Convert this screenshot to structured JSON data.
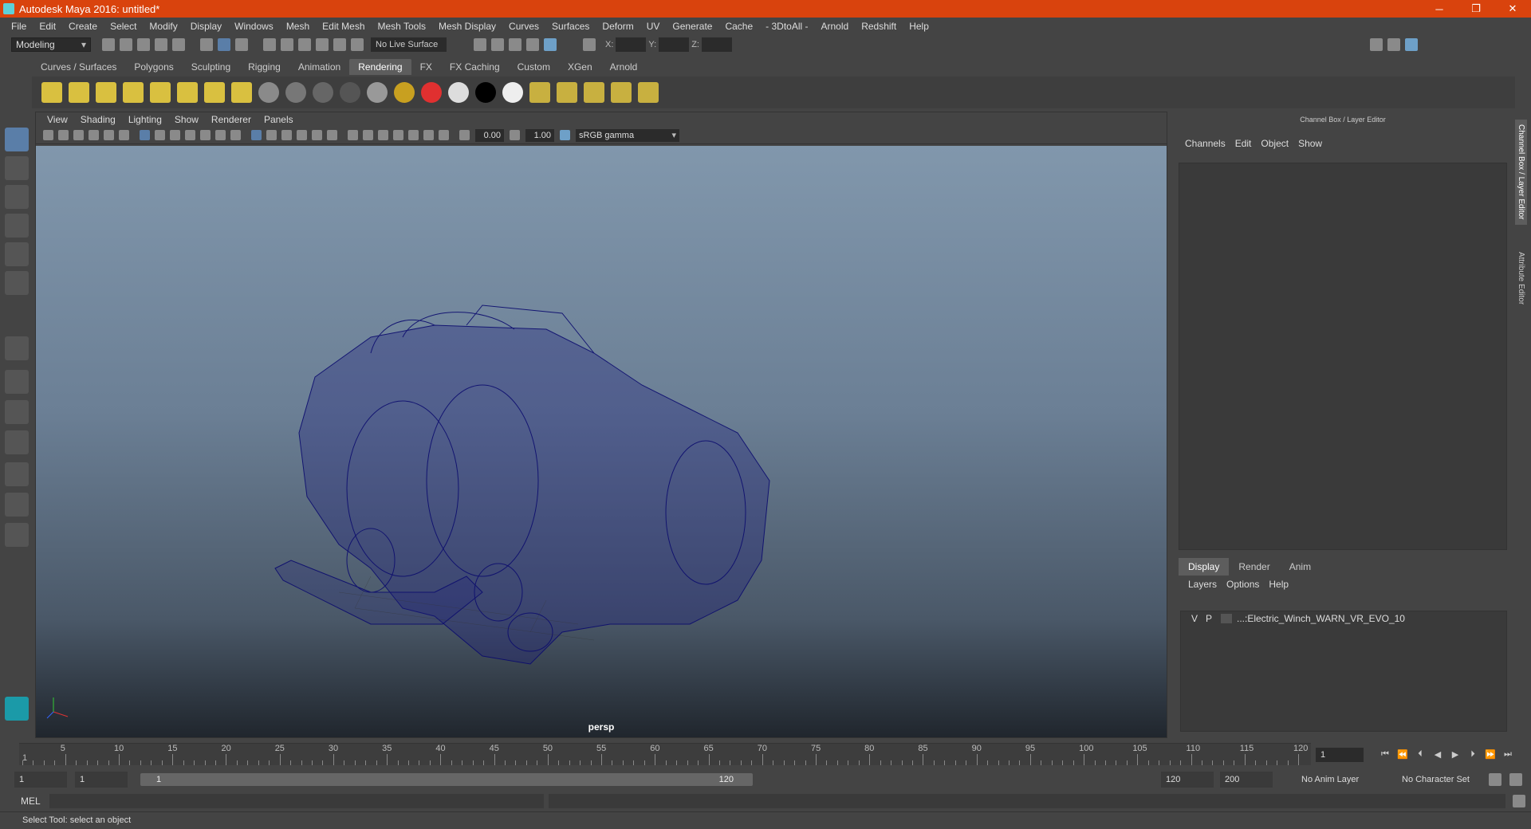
{
  "window": {
    "title": "Autodesk Maya 2016: untitled*"
  },
  "menus": [
    "File",
    "Edit",
    "Create",
    "Select",
    "Modify",
    "Display",
    "Windows",
    "Mesh",
    "Edit Mesh",
    "Mesh Tools",
    "Mesh Display",
    "Curves",
    "Surfaces",
    "Deform",
    "UV",
    "Generate",
    "Cache",
    "- 3DtoAll -",
    "Arnold",
    "Redshift",
    "Help"
  ],
  "status_line": {
    "mode": "Modeling",
    "live_surface": "No Live Surface",
    "x_label": "X:",
    "y_label": "Y:",
    "z_label": "Z:"
  },
  "shelf_tabs": [
    {
      "label": "Curves / Surfaces",
      "active": false
    },
    {
      "label": "Polygons",
      "active": false
    },
    {
      "label": "Sculpting",
      "active": false
    },
    {
      "label": "Rigging",
      "active": false
    },
    {
      "label": "Animation",
      "active": false
    },
    {
      "label": "Rendering",
      "active": true
    },
    {
      "label": "FX",
      "active": false
    },
    {
      "label": "FX Caching",
      "active": false
    },
    {
      "label": "Custom",
      "active": false
    },
    {
      "label": "XGen",
      "active": false
    },
    {
      "label": "Arnold",
      "active": false
    }
  ],
  "panel_menu": [
    "View",
    "Shading",
    "Lighting",
    "Show",
    "Renderer",
    "Panels"
  ],
  "panel_toolbar": {
    "exposure": "0.00",
    "gamma": "1.00",
    "color_space": "sRGB gamma"
  },
  "viewport": {
    "camera": "persp"
  },
  "channel_box": {
    "title": "Channel Box / Layer Editor",
    "menu": [
      "Channels",
      "Edit",
      "Object",
      "Show"
    ]
  },
  "layer_editor": {
    "tabs": [
      {
        "label": "Display",
        "active": true
      },
      {
        "label": "Render",
        "active": false
      },
      {
        "label": "Anim",
        "active": false
      }
    ],
    "menu": [
      "Layers",
      "Options",
      "Help"
    ],
    "layer": {
      "v": "V",
      "p": "P",
      "name": "...:Electric_Winch_WARN_VR_EVO_10"
    }
  },
  "right_tabs": [
    "Channel Box / Layer Editor",
    "Attribute Editor"
  ],
  "timeline": {
    "ticks": [
      "5",
      "10",
      "15",
      "20",
      "25",
      "30",
      "35",
      "40",
      "45",
      "50",
      "55",
      "60",
      "65",
      "70",
      "75",
      "80",
      "85",
      "90",
      "95",
      "100",
      "105",
      "110",
      "115",
      "120"
    ],
    "start": "1",
    "current_frame": "1"
  },
  "range": {
    "start": "1",
    "playback_start": "1",
    "slider_start": "1",
    "slider_end": "120",
    "playback_end": "120",
    "end": "200",
    "anim_layer": "No Anim Layer",
    "char_set": "No Character Set"
  },
  "command_line": {
    "label": "MEL"
  },
  "help_line": "Select Tool: select an object"
}
